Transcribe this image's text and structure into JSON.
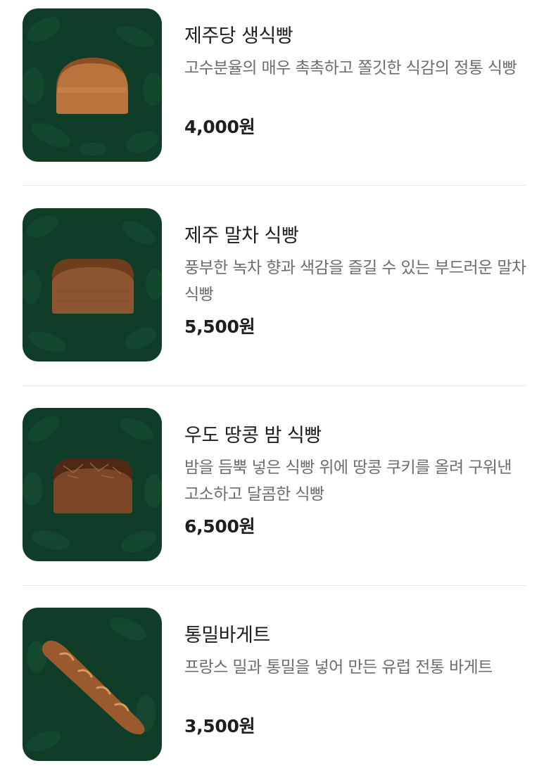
{
  "menu": {
    "items": [
      {
        "name": "제주당 생식빵",
        "description": "고수분율의 매우 촉촉하고 쫄깃한 식감의 정통 식빵",
        "price": "4,000원",
        "image_icon": "bread-loaf-icon"
      },
      {
        "name": "제주 말차 식빵",
        "description": "풍부한 녹차 향과 색감을 즐길 수 있는 부드러운 말차 식빵",
        "price": "5,500원",
        "image_icon": "bread-loaf-icon"
      },
      {
        "name": "우도 땅콩 밤 식빵",
        "description": "밤을 듬뿍 넣은 식빵 위에 땅콩 쿠키를 올려 구워낸 고소하고 달콤한 식빵",
        "price": "6,500원",
        "image_icon": "bread-loaf-icon"
      },
      {
        "name": "통밀바게트",
        "description": "프랑스 밀과 통밀을 넣어 만든 유럽 전통 바게트",
        "price": "3,500원",
        "image_icon": "baguette-icon"
      }
    ]
  },
  "colors": {
    "thumbnail_bg": "#0f3d27",
    "name_text": "#1e1e1e",
    "desc_text": "#6d6d6d",
    "divider": "#ebebeb"
  }
}
